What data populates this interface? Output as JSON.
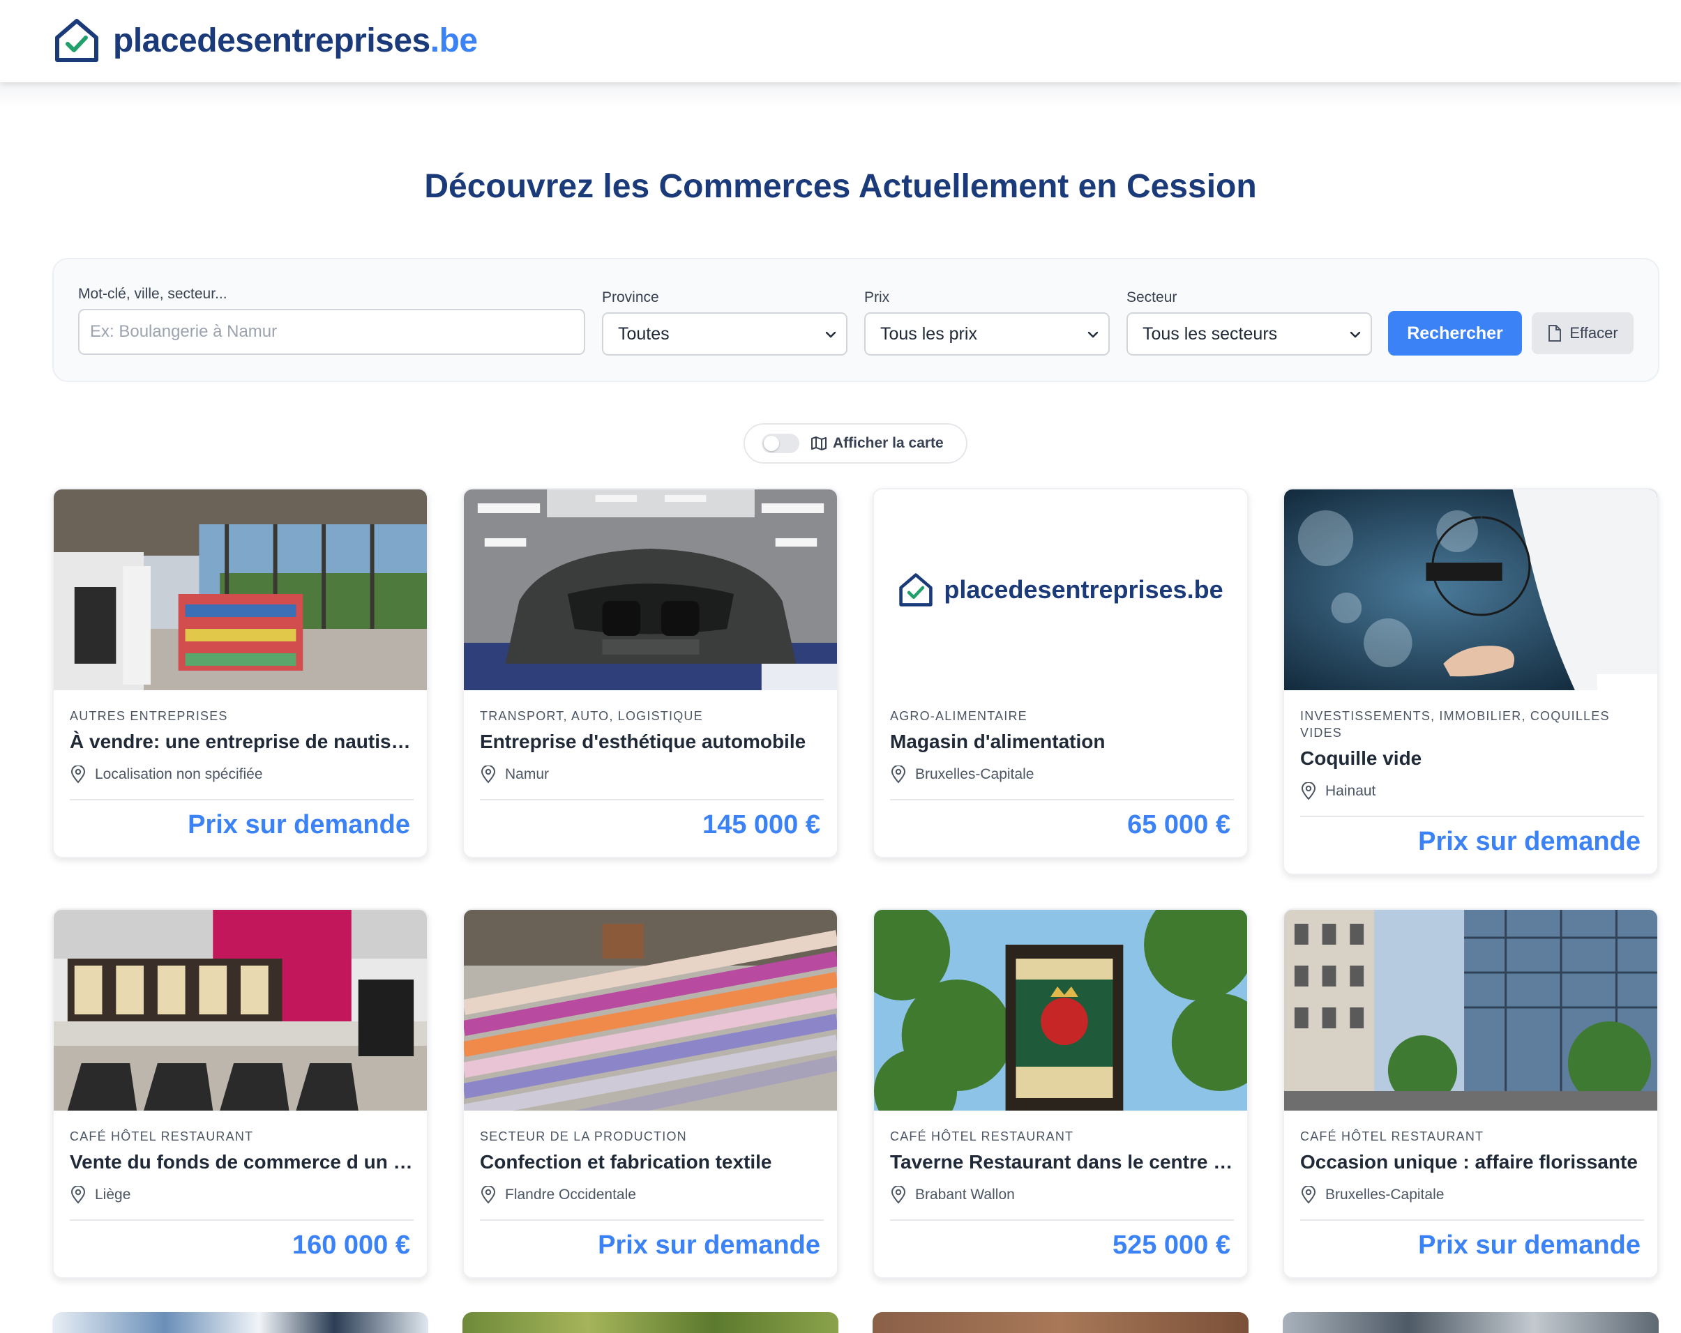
{
  "brand": {
    "name": "placedesentreprises",
    "tld": ".be"
  },
  "page_title": "Découvrez les Commerces Actuellement en Cession",
  "search": {
    "keyword_label": "Mot-clé, ville, secteur...",
    "keyword_placeholder": "Ex: Boulangerie à Namur",
    "province_label": "Province",
    "province_value": "Toutes",
    "price_label": "Prix",
    "price_value": "Tous les prix",
    "sector_label": "Secteur",
    "sector_value": "Tous les secteurs",
    "search_button": "Rechercher",
    "clear_button": "Effacer"
  },
  "map_toggle": {
    "label": "Afficher la carte",
    "enabled": false
  },
  "colors": {
    "brand_navy": "#1b3a7a",
    "accent_blue": "#3b82f6"
  },
  "listings": [
    {
      "category": "Autres entreprises",
      "title": "À vendre: une entreprise de nautisme",
      "location": "Localisation non spécifiée",
      "price": "Prix sur demande",
      "image": "boat-shop-interior"
    },
    {
      "category": "Transport, auto, logistique",
      "title": "Entreprise d'esthétique automobile",
      "location": "Namur",
      "price": "145 000 €",
      "image": "car-detailing-studio"
    },
    {
      "category": "Agro-alimentaire",
      "title": "Magasin d'alimentation",
      "location": "Bruxelles-Capitale",
      "price": "65 000 €",
      "image": "brand-placeholder",
      "image_brand_text": "placedesentreprises.be"
    },
    {
      "category": "Investissements, immobilier, coquilles vides",
      "title": "Coquille vide",
      "location": "Hainaut",
      "price": "Prix sur demande",
      "image": "business-word-cloud"
    },
    {
      "category": "Café hôtel restaurant",
      "title": "Vente du fonds de commerce d un bar",
      "location": "Liège",
      "price": "160 000 €",
      "image": "bar-counter"
    },
    {
      "category": "Secteur de la production",
      "title": "Confection et fabrication textile",
      "location": "Flandre Occidentale",
      "price": "Prix sur demande",
      "image": "woven-textile"
    },
    {
      "category": "Café hôtel restaurant",
      "title": "Taverne Restaurant dans le centre ville",
      "location": "Brabant Wallon",
      "price": "525 000 €",
      "image": "pub-sign-trees"
    },
    {
      "category": "Café hôtel restaurant",
      "title": "Occasion unique : affaire florissante",
      "location": "Bruxelles-Capitale",
      "price": "Prix sur demande",
      "image": "city-street-buildings"
    }
  ]
}
